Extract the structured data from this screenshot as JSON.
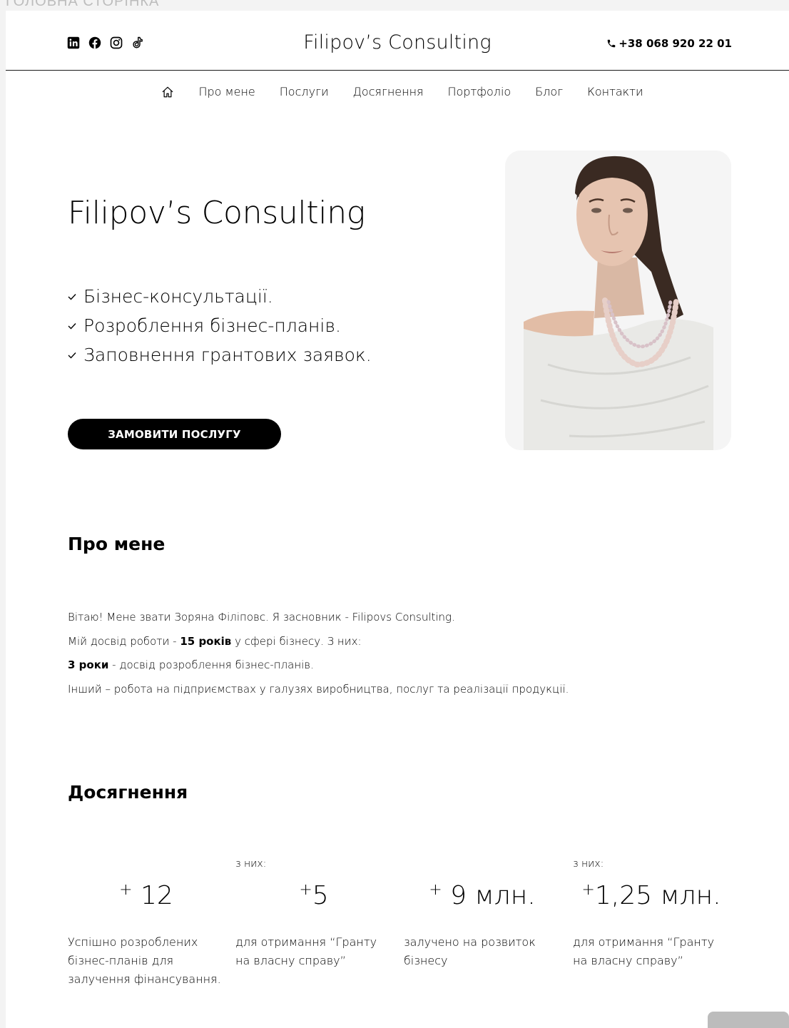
{
  "page_label": "ГОЛОВНА СТОРІНКА",
  "header": {
    "brand": "Filipov’s Consulting",
    "phone": "+38 068 920 22 01",
    "socials": [
      "linkedin-icon",
      "facebook-icon",
      "instagram-icon",
      "tiktok-icon"
    ]
  },
  "nav": {
    "items": [
      {
        "label": "Про мене"
      },
      {
        "label": "Послуги"
      },
      {
        "label": "Досягнення"
      },
      {
        "label": "Портфоліо"
      },
      {
        "label": "Блог"
      },
      {
        "label": "Контакти"
      }
    ]
  },
  "hero": {
    "title": "Filipov’s Consulting",
    "bullets": [
      "Бізнес-консультації.",
      "Розроблення бізнес-планів.",
      "Заповнення грантових заявок."
    ],
    "cta": "ЗАМОВИТИ ПОСЛУГУ"
  },
  "about": {
    "heading": "Про мене",
    "line1": "Вітаю! Мене звати Зоряна Філіповс. Я засновник - Filipovs Consulting.",
    "line2_pre": "Мій досвід роботи - ",
    "line2_bold": "15 років",
    "line2_post": " у сфері бізнесу. З них:",
    "line3_bold": "3 роки",
    "line3_post": " - досвід розроблення бізнес-планів.",
    "line4": "Інший – робота на підприємствах у галузях виробництва, послуг та реалізації продукції."
  },
  "achievements": {
    "heading": "Досягнення",
    "stats": [
      {
        "note": "",
        "plus": "+",
        "value": " 12",
        "desc": "Успішно розроблених бізнес-планів для залучення фінансування."
      },
      {
        "note": "з них:",
        "plus": "+",
        "value": "5",
        "desc": "для отримання “Гранту на власну справу”"
      },
      {
        "note": "",
        "plus": "+",
        "value": " 9 млн.",
        "desc": "залучено на розвиток бізнесу"
      },
      {
        "note": "з них:",
        "plus": "+",
        "value": "1,25 млн.",
        "desc": "для отримання “Гранту на власну справу”"
      }
    ]
  },
  "colors": {
    "accent": "#000000",
    "background": "#ffffff",
    "page_bg": "#f3f3f3"
  }
}
